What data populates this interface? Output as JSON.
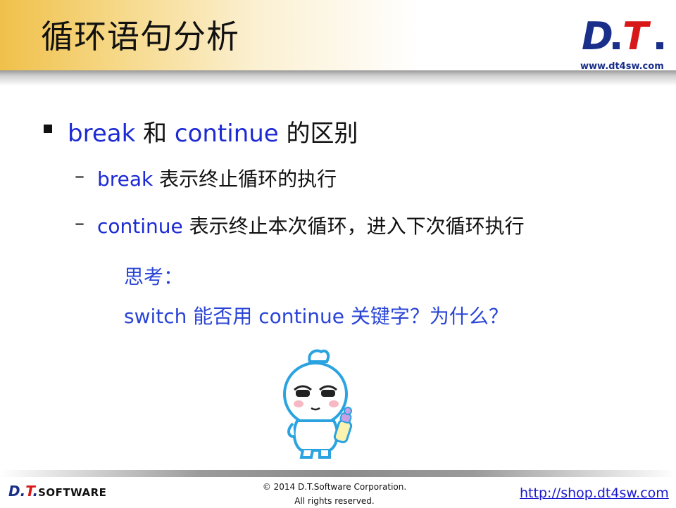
{
  "header": {
    "title": "循环语句分析",
    "logo_url_text": "www.dt4sw.com"
  },
  "content": {
    "bullet": {
      "kw1": "break",
      "and": " 和 ",
      "kw2": "continue",
      "rest": " 的区别"
    },
    "sub1": {
      "dash": "–",
      "kw": "break",
      "text": " 表示终止循环的执行"
    },
    "sub2": {
      "dash": "–",
      "kw": "continue",
      "text": " 表示终止本次循环，进入下次循环执行"
    },
    "think_label": "思考：",
    "think_question": "switch 能否用 continue 关键字？为什么？"
  },
  "footer": {
    "logo_d": "D.",
    "logo_t": "T",
    "logo_dot": ".",
    "logo_software": "SOFTWARE",
    "copyright_line1": "© 2014 D.T.Software Corporation.",
    "copyright_line2": "All rights reserved.",
    "shop_link": "http://shop.dt4sw.com"
  },
  "colors": {
    "keyword_blue": "#1c2ad3",
    "think_blue": "#2a45d6",
    "header_gold": "#f0c04a",
    "brand_navy": "#1a2f8a",
    "brand_red": "#d81818"
  }
}
